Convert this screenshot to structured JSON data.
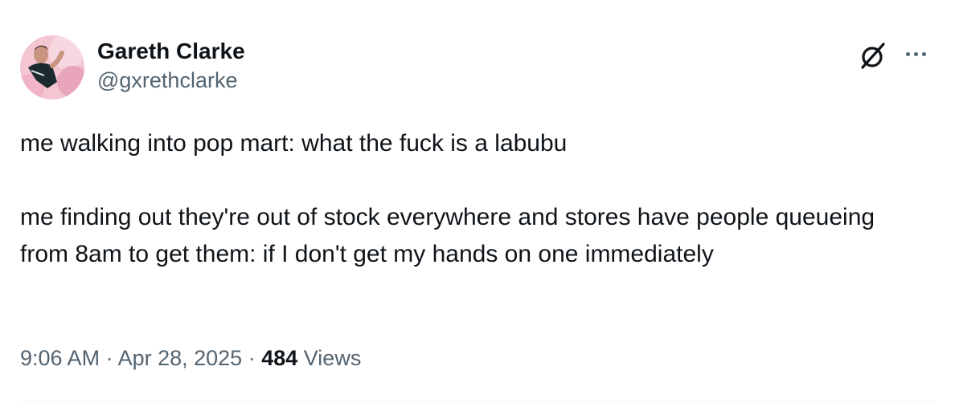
{
  "author": {
    "display_name": "Gareth Clarke",
    "handle": "@gxrethclarke",
    "avatar_icon": "avatar"
  },
  "header_actions": {
    "grok_icon": "grok-icon",
    "more_icon": "more-icon"
  },
  "tweet": {
    "line_1": "me walking into pop mart: what the fuck is a labubu",
    "line_2": "me finding out they're out of stock everywhere and stores have people queueing from 8am to get them: if I don't get my hands on one immediately"
  },
  "meta": {
    "time": "9:06 AM",
    "separator": " · ",
    "date": "Apr 28, 2025",
    "views_count": "484",
    "views_label": "Views"
  },
  "colors": {
    "text_primary": "#0f1419",
    "text_secondary": "#536471",
    "divider": "#eff3f4"
  }
}
